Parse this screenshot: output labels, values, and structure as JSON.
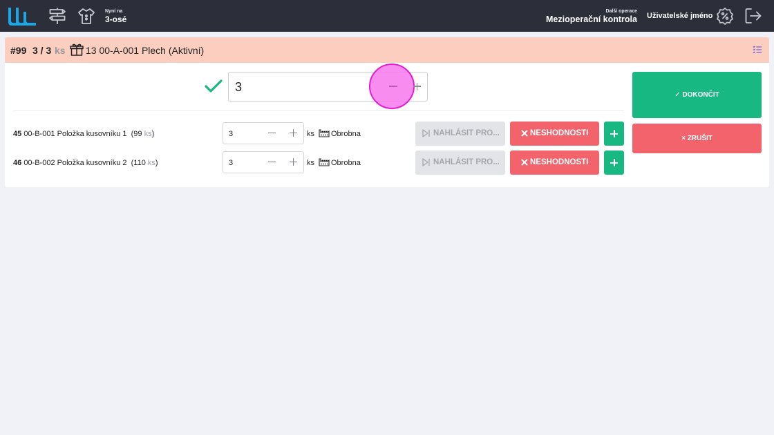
{
  "topbar": {
    "now_label": "Nyní na",
    "now_value": "3-osé",
    "next_op_label": "Další operace",
    "next_op_value": "Mezioperační kontrola",
    "username": "Uživatelské jméno"
  },
  "order": {
    "id": "#99",
    "qty": "3 / 3",
    "unit": "ks",
    "title": "13 00-A-001 Plech (Aktivní)",
    "quantity_value": "3"
  },
  "actions": {
    "finish_label": "✓ DOKONČIT",
    "cancel_label": "× ZRUŠIT"
  },
  "rows": [
    {
      "num": "45",
      "name": "00-B-001 Položka kusovníku 1",
      "stock_open": "(99",
      "stock_unit": "ks",
      "stock_close": ")",
      "value": "3",
      "unit": "ks",
      "workstation": "Obrobna",
      "report_label": "NAHLÁSIT PRO...",
      "nc_label": "NESHODNOSTI"
    },
    {
      "num": "46",
      "name": "00-B-002 Položka kusovníku 2",
      "stock_open": "(110",
      "stock_unit": "ks",
      "stock_close": ")",
      "value": "3",
      "unit": "ks",
      "workstation": "Obrobna",
      "report_label": "NAHLÁSIT PRO...",
      "nc_label": "NESHODNOSTI"
    }
  ],
  "colors": {
    "topbar": "#2c2f3a",
    "header": "#fbcebf",
    "success": "#18b883",
    "danger": "#f2636c",
    "logo": "#1aa7e8"
  }
}
